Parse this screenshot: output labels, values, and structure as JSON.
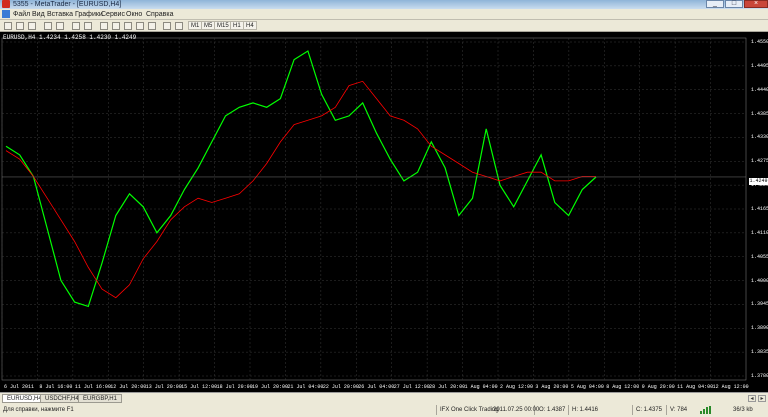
{
  "window": {
    "title": "5355 - MetaTrader - [EURUSD,H4]"
  },
  "menu": {
    "items": [
      "Файл",
      "Вид",
      "Вставка",
      "Графики",
      "Сервис",
      "Окно",
      "Справка"
    ]
  },
  "toolbar": {
    "timeframes": [
      "M1",
      "M5",
      "M15",
      "H1",
      "H4"
    ]
  },
  "chart": {
    "symbol_label": "EURUSD,H4 1.4234 1.4258 1.4230 1.4249",
    "current_price": "1.4249",
    "price_ticks": [
      "1.4550",
      "1.4495",
      "1.4440",
      "1.4385",
      "1.4330",
      "1.4275",
      "1.4220",
      "1.4165",
      "1.4110",
      "1.4055",
      "1.4000",
      "1.3945",
      "1.3890",
      "1.3835",
      "1.3780"
    ],
    "time_ticks": [
      "6 Jul 2011",
      "8 Jul 16:00",
      "11 Jul 16:00",
      "12 Jul 20:00",
      "13 Jul 20:00",
      "15 Jul 12:00",
      "18 Jul 20:00",
      "19 Jul 20:00",
      "21 Jul 04:00",
      "22 Jul 20:00",
      "26 Jul 04:00",
      "27 Jul 12:00",
      "28 Jul 20:00",
      "1 Aug 04:00",
      "2 Aug 12:00",
      "3 Aug 20:00",
      "5 Aug 04:00",
      "8 Aug 12:00",
      "9 Aug 20:00",
      "11 Aug 04:00",
      "12 Aug 12:00"
    ],
    "colors": {
      "background": "#000000",
      "candle": "#00ff00",
      "ma": "#ff0000",
      "grid": "#3a3a3a"
    }
  },
  "chart_data": {
    "type": "line",
    "series": [
      {
        "values": [
          1.431,
          1.429,
          1.425,
          1.42,
          1.415,
          1.41,
          1.404,
          1.399,
          1.397,
          1.4,
          1.406,
          1.41,
          1.415,
          1.418,
          1.42,
          1.419,
          1.42,
          1.421,
          1.424,
          1.428,
          1.433,
          1.437,
          1.438,
          1.439,
          1.441,
          1.446,
          1.447,
          1.443,
          1.439,
          1.438,
          1.436,
          1.432,
          1.43,
          1.428,
          1.426,
          1.425,
          1.424,
          1.425,
          1.426,
          1.426,
          1.424,
          1.424,
          1.425,
          1.425
        ]
      },
      {
        "values": [
          1.432,
          1.43,
          1.425,
          1.413,
          1.401,
          1.396,
          1.395,
          1.405,
          1.416,
          1.421,
          1.418,
          1.412,
          1.416,
          1.422,
          1.427,
          1.433,
          1.439,
          1.441,
          1.442,
          1.441,
          1.443,
          1.452,
          1.454,
          1.444,
          1.438,
          1.439,
          1.442,
          1.435,
          1.429,
          1.424,
          1.426,
          1.433,
          1.427,
          1.416,
          1.42,
          1.436,
          1.423,
          1.418,
          1.424,
          1.43,
          1.419,
          1.416,
          1.422,
          1.4249
        ]
      }
    ],
    "ylim": [
      1.378,
      1.457
    ]
  },
  "tabs": [
    {
      "label": "EURUSD,H4",
      "active": true
    },
    {
      "label": "USDCHF,H4",
      "active": false
    },
    {
      "label": "EURGBP,H1",
      "active": false
    }
  ],
  "status": {
    "help": "Для справки, нажмите F1",
    "profile": "IFX One Click Trading",
    "datetime": "2011.07.25 00:00",
    "open": "O: 1.4387",
    "high": "H: 1.4416",
    "close": "C: 1.4375",
    "volume": "V: 784",
    "traffic": "36/3 kb"
  }
}
